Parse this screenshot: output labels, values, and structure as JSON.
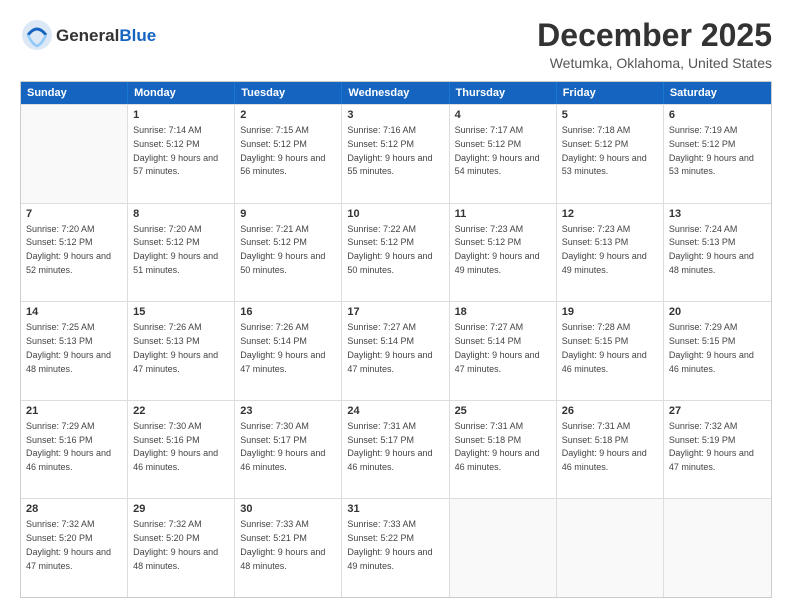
{
  "logo": {
    "general": "General",
    "blue": "Blue"
  },
  "title": "December 2025",
  "location": "Wetumka, Oklahoma, United States",
  "days": [
    "Sunday",
    "Monday",
    "Tuesday",
    "Wednesday",
    "Thursday",
    "Friday",
    "Saturday"
  ],
  "weeks": [
    [
      {
        "day": "",
        "sunrise": "",
        "sunset": "",
        "daylight": "",
        "empty": true
      },
      {
        "day": "1",
        "sunrise": "Sunrise: 7:14 AM",
        "sunset": "Sunset: 5:12 PM",
        "daylight": "Daylight: 9 hours and 57 minutes."
      },
      {
        "day": "2",
        "sunrise": "Sunrise: 7:15 AM",
        "sunset": "Sunset: 5:12 PM",
        "daylight": "Daylight: 9 hours and 56 minutes."
      },
      {
        "day": "3",
        "sunrise": "Sunrise: 7:16 AM",
        "sunset": "Sunset: 5:12 PM",
        "daylight": "Daylight: 9 hours and 55 minutes."
      },
      {
        "day": "4",
        "sunrise": "Sunrise: 7:17 AM",
        "sunset": "Sunset: 5:12 PM",
        "daylight": "Daylight: 9 hours and 54 minutes."
      },
      {
        "day": "5",
        "sunrise": "Sunrise: 7:18 AM",
        "sunset": "Sunset: 5:12 PM",
        "daylight": "Daylight: 9 hours and 53 minutes."
      },
      {
        "day": "6",
        "sunrise": "Sunrise: 7:19 AM",
        "sunset": "Sunset: 5:12 PM",
        "daylight": "Daylight: 9 hours and 53 minutes."
      }
    ],
    [
      {
        "day": "7",
        "sunrise": "Sunrise: 7:20 AM",
        "sunset": "Sunset: 5:12 PM",
        "daylight": "Daylight: 9 hours and 52 minutes."
      },
      {
        "day": "8",
        "sunrise": "Sunrise: 7:20 AM",
        "sunset": "Sunset: 5:12 PM",
        "daylight": "Daylight: 9 hours and 51 minutes."
      },
      {
        "day": "9",
        "sunrise": "Sunrise: 7:21 AM",
        "sunset": "Sunset: 5:12 PM",
        "daylight": "Daylight: 9 hours and 50 minutes."
      },
      {
        "day": "10",
        "sunrise": "Sunrise: 7:22 AM",
        "sunset": "Sunset: 5:12 PM",
        "daylight": "Daylight: 9 hours and 50 minutes."
      },
      {
        "day": "11",
        "sunrise": "Sunrise: 7:23 AM",
        "sunset": "Sunset: 5:12 PM",
        "daylight": "Daylight: 9 hours and 49 minutes."
      },
      {
        "day": "12",
        "sunrise": "Sunrise: 7:23 AM",
        "sunset": "Sunset: 5:13 PM",
        "daylight": "Daylight: 9 hours and 49 minutes."
      },
      {
        "day": "13",
        "sunrise": "Sunrise: 7:24 AM",
        "sunset": "Sunset: 5:13 PM",
        "daylight": "Daylight: 9 hours and 48 minutes."
      }
    ],
    [
      {
        "day": "14",
        "sunrise": "Sunrise: 7:25 AM",
        "sunset": "Sunset: 5:13 PM",
        "daylight": "Daylight: 9 hours and 48 minutes."
      },
      {
        "day": "15",
        "sunrise": "Sunrise: 7:26 AM",
        "sunset": "Sunset: 5:13 PM",
        "daylight": "Daylight: 9 hours and 47 minutes."
      },
      {
        "day": "16",
        "sunrise": "Sunrise: 7:26 AM",
        "sunset": "Sunset: 5:14 PM",
        "daylight": "Daylight: 9 hours and 47 minutes."
      },
      {
        "day": "17",
        "sunrise": "Sunrise: 7:27 AM",
        "sunset": "Sunset: 5:14 PM",
        "daylight": "Daylight: 9 hours and 47 minutes."
      },
      {
        "day": "18",
        "sunrise": "Sunrise: 7:27 AM",
        "sunset": "Sunset: 5:14 PM",
        "daylight": "Daylight: 9 hours and 47 minutes."
      },
      {
        "day": "19",
        "sunrise": "Sunrise: 7:28 AM",
        "sunset": "Sunset: 5:15 PM",
        "daylight": "Daylight: 9 hours and 46 minutes."
      },
      {
        "day": "20",
        "sunrise": "Sunrise: 7:29 AM",
        "sunset": "Sunset: 5:15 PM",
        "daylight": "Daylight: 9 hours and 46 minutes."
      }
    ],
    [
      {
        "day": "21",
        "sunrise": "Sunrise: 7:29 AM",
        "sunset": "Sunset: 5:16 PM",
        "daylight": "Daylight: 9 hours and 46 minutes."
      },
      {
        "day": "22",
        "sunrise": "Sunrise: 7:30 AM",
        "sunset": "Sunset: 5:16 PM",
        "daylight": "Daylight: 9 hours and 46 minutes."
      },
      {
        "day": "23",
        "sunrise": "Sunrise: 7:30 AM",
        "sunset": "Sunset: 5:17 PM",
        "daylight": "Daylight: 9 hours and 46 minutes."
      },
      {
        "day": "24",
        "sunrise": "Sunrise: 7:31 AM",
        "sunset": "Sunset: 5:17 PM",
        "daylight": "Daylight: 9 hours and 46 minutes."
      },
      {
        "day": "25",
        "sunrise": "Sunrise: 7:31 AM",
        "sunset": "Sunset: 5:18 PM",
        "daylight": "Daylight: 9 hours and 46 minutes."
      },
      {
        "day": "26",
        "sunrise": "Sunrise: 7:31 AM",
        "sunset": "Sunset: 5:18 PM",
        "daylight": "Daylight: 9 hours and 46 minutes."
      },
      {
        "day": "27",
        "sunrise": "Sunrise: 7:32 AM",
        "sunset": "Sunset: 5:19 PM",
        "daylight": "Daylight: 9 hours and 47 minutes."
      }
    ],
    [
      {
        "day": "28",
        "sunrise": "Sunrise: 7:32 AM",
        "sunset": "Sunset: 5:20 PM",
        "daylight": "Daylight: 9 hours and 47 minutes."
      },
      {
        "day": "29",
        "sunrise": "Sunrise: 7:32 AM",
        "sunset": "Sunset: 5:20 PM",
        "daylight": "Daylight: 9 hours and 48 minutes."
      },
      {
        "day": "30",
        "sunrise": "Sunrise: 7:33 AM",
        "sunset": "Sunset: 5:21 PM",
        "daylight": "Daylight: 9 hours and 48 minutes."
      },
      {
        "day": "31",
        "sunrise": "Sunrise: 7:33 AM",
        "sunset": "Sunset: 5:22 PM",
        "daylight": "Daylight: 9 hours and 49 minutes."
      },
      {
        "day": "",
        "sunrise": "",
        "sunset": "",
        "daylight": "",
        "empty": true
      },
      {
        "day": "",
        "sunrise": "",
        "sunset": "",
        "daylight": "",
        "empty": true
      },
      {
        "day": "",
        "sunrise": "",
        "sunset": "",
        "daylight": "",
        "empty": true
      }
    ]
  ]
}
